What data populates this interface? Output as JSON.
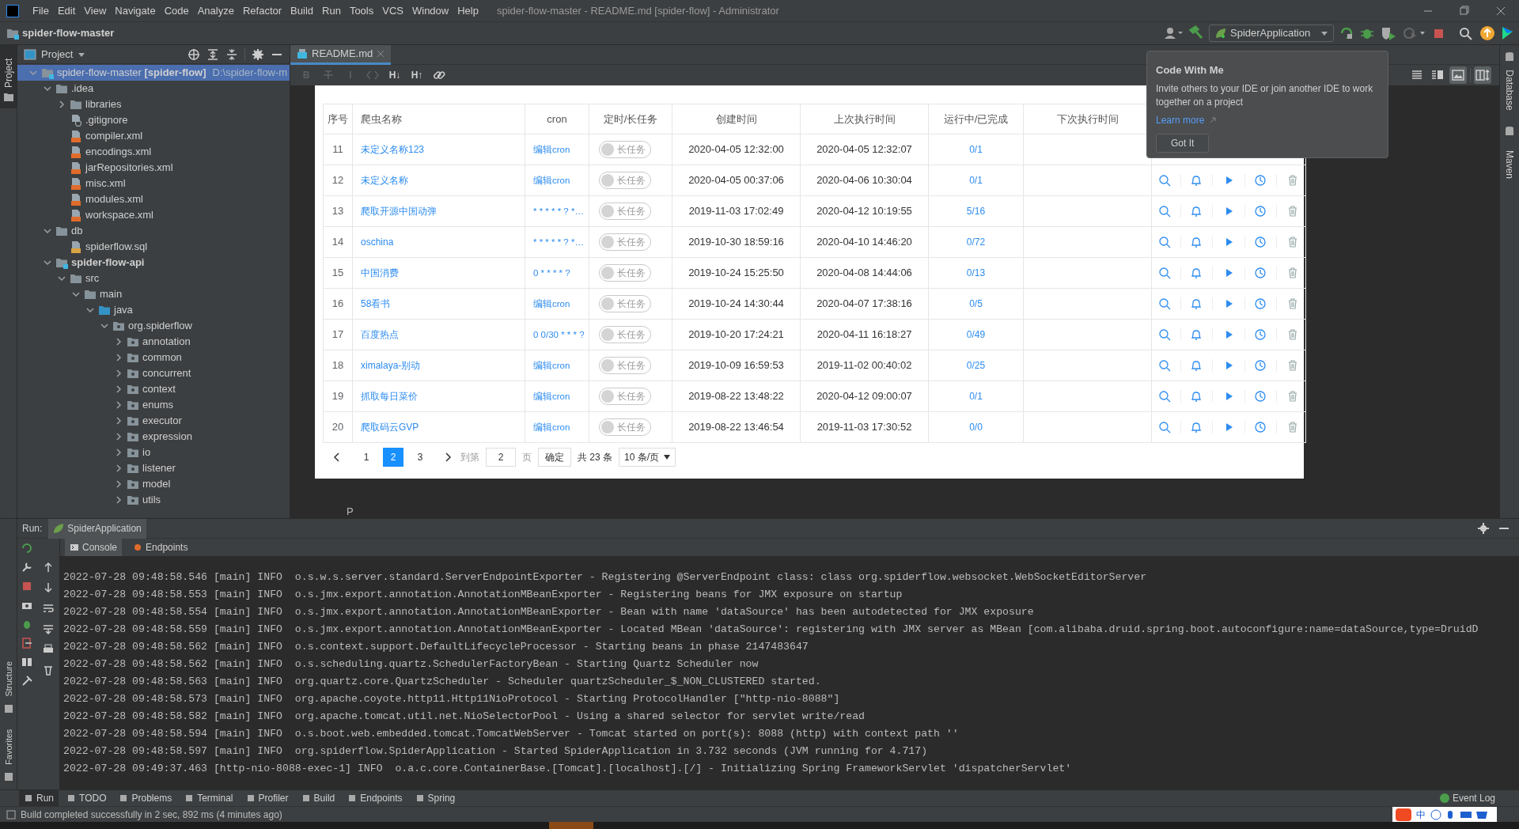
{
  "title_bar": {
    "menu": [
      "File",
      "Edit",
      "View",
      "Navigate",
      "Code",
      "Analyze",
      "Refactor",
      "Build",
      "Run",
      "Tools",
      "VCS",
      "Window",
      "Help"
    ],
    "title": "spider-flow-master - README.md [spider-flow] - Administrator"
  },
  "nav_bar": {
    "breadcrumb": "spider-flow-master",
    "run_config": "SpiderApplication"
  },
  "popup": {
    "title": "Code With Me",
    "text": "Invite others to your IDE or join another IDE to work together on a project",
    "link": "Learn more",
    "button": "Got It"
  },
  "left_stripe": {
    "label": "Project",
    "selected": true
  },
  "project_panel": {
    "title": "Project",
    "tree": [
      {
        "label": "spider-flow-master **[spider-flow]**",
        "path": "D:\\spider-flow-m",
        "kind": "module",
        "bold": false,
        "selected": true,
        "expanded": true,
        "children": [
          {
            "label": ".idea",
            "kind": "folder",
            "bold": false,
            "selected": false,
            "expanded": true,
            "children": [
              {
                "label": "libraries",
                "kind": "folder",
                "bold": false,
                "selected": false,
                "expanded": false
              },
              {
                "label": ".gitignore",
                "kind": "ignore",
                "bold": false,
                "selected": false
              },
              {
                "label": "compiler.xml",
                "kind": "xml",
                "bold": false,
                "selected": false
              },
              {
                "label": "encodings.xml",
                "kind": "xml",
                "bold": false,
                "selected": false
              },
              {
                "label": "jarRepositories.xml",
                "kind": "xml",
                "bold": false,
                "selected": false
              },
              {
                "label": "misc.xml",
                "kind": "xml",
                "bold": false,
                "selected": false
              },
              {
                "label": "modules.xml",
                "kind": "xml",
                "bold": false,
                "selected": false
              },
              {
                "label": "workspace.xml",
                "kind": "xml",
                "bold": false,
                "selected": false
              }
            ]
          },
          {
            "label": "db",
            "kind": "folder",
            "bold": false,
            "selected": false,
            "expanded": true,
            "children": [
              {
                "label": "spiderflow.sql",
                "kind": "sql",
                "bold": false,
                "selected": false
              }
            ]
          },
          {
            "label": "spider-flow-api",
            "kind": "module",
            "bold": true,
            "selected": false,
            "expanded": true,
            "children": [
              {
                "label": "src",
                "kind": "folder",
                "bold": false,
                "selected": false,
                "expanded": true,
                "children": [
                  {
                    "label": "main",
                    "kind": "folder",
                    "bold": false,
                    "selected": false,
                    "expanded": true,
                    "children": [
                      {
                        "label": "java",
                        "kind": "source",
                        "bold": false,
                        "selected": false,
                        "expanded": true,
                        "children": [
                          {
                            "label": "org.spiderflow",
                            "kind": "package",
                            "bold": false,
                            "selected": false,
                            "expanded": true,
                            "children": [
                              {
                                "label": "annotation",
                                "kind": "package",
                                "bold": false,
                                "selected": false,
                                "expanded": false
                              },
                              {
                                "label": "common",
                                "kind": "package",
                                "bold": false,
                                "selected": false,
                                "expanded": false
                              },
                              {
                                "label": "concurrent",
                                "kind": "package",
                                "bold": false,
                                "selected": false,
                                "expanded": false
                              },
                              {
                                "label": "context",
                                "kind": "package",
                                "bold": false,
                                "selected": false,
                                "expanded": false
                              },
                              {
                                "label": "enums",
                                "kind": "package",
                                "bold": false,
                                "selected": false,
                                "expanded": false
                              },
                              {
                                "label": "executor",
                                "kind": "package",
                                "bold": false,
                                "selected": false,
                                "expanded": false
                              },
                              {
                                "label": "expression",
                                "kind": "package",
                                "bold": false,
                                "selected": false,
                                "expanded": false
                              },
                              {
                                "label": "io",
                                "kind": "package",
                                "bold": false,
                                "selected": false,
                                "expanded": false
                              },
                              {
                                "label": "listener",
                                "kind": "package",
                                "bold": false,
                                "selected": false,
                                "expanded": false
                              },
                              {
                                "label": "model",
                                "kind": "package",
                                "bold": false,
                                "selected": false,
                                "expanded": false
                              },
                              {
                                "label": "utils",
                                "kind": "package",
                                "bold": false,
                                "selected": false,
                                "expanded": false
                              }
                            ]
                          }
                        ]
                      }
                    ]
                  }
                ]
              }
            ]
          }
        ]
      }
    ]
  },
  "editor": {
    "tabs": [
      {
        "label": "README.md",
        "selected": true
      }
    ],
    "format_buttons": [
      {
        "kind": "text",
        "label": "B",
        "disabled": true
      },
      {
        "kind": "strike",
        "disabled": true
      },
      {
        "kind": "text",
        "label": "I",
        "disabled": true
      },
      {
        "kind": "code",
        "disabled": true
      },
      {
        "kind": "text",
        "label": "H↓",
        "disabled": false
      },
      {
        "kind": "text",
        "label": "H↑",
        "disabled": false
      },
      {
        "kind": "link",
        "disabled": false
      }
    ],
    "view_modes": [
      {
        "kind": "editor",
        "selected": false
      },
      {
        "kind": "split",
        "selected": false
      },
      {
        "kind": "preview",
        "selected": true
      }
    ],
    "scroll_sync": true,
    "preview": {
      "table": {
        "columns": [
          "序号",
          "爬虫名称",
          "cron",
          "定时/长任务",
          "创建时间",
          "上次执行时间",
          "运行中/已完成",
          "下次执行时间"
        ],
        "rows": [
          {
            "no": "11",
            "name": "未定义名称123",
            "cron": "编辑cron",
            "toggle": {
              "label": "长任务",
              "on": false
            },
            "created": "2020-04-05 12:32:00",
            "last_run": "2020-04-05 12:32:07",
            "progress": "0/1"
          },
          {
            "no": "12",
            "name": "未定义名称",
            "cron": "编辑cron",
            "toggle": {
              "label": "长任务",
              "on": false
            },
            "created": "2020-04-05 00:37:06",
            "last_run": "2020-04-06 10:30:04",
            "progress": "0/1"
          },
          {
            "no": "13",
            "name": "爬取开源中国动弹",
            "cron": "* * * * * ? *…",
            "toggle": {
              "label": "长任务",
              "on": false
            },
            "created": "2019-11-03 17:02:49",
            "last_run": "2020-04-12 10:19:55",
            "progress": "5/16"
          },
          {
            "no": "14",
            "name": "oschina",
            "cron": "* * * * * ? *…",
            "toggle": {
              "label": "长任务",
              "on": false
            },
            "created": "2019-10-30 18:59:16",
            "last_run": "2020-04-10 14:46:20",
            "progress": "0/72"
          },
          {
            "no": "15",
            "name": "中国消费",
            "cron": "0 * * * * ?",
            "toggle": {
              "label": "长任务",
              "on": false
            },
            "created": "2019-10-24 15:25:50",
            "last_run": "2020-04-08 14:44:06",
            "progress": "0/13"
          },
          {
            "no": "16",
            "name": "58看书",
            "cron": "编辑cron",
            "toggle": {
              "label": "长任务",
              "on": false
            },
            "created": "2019-10-24 14:30:44",
            "last_run": "2020-04-07 17:38:16",
            "progress": "0/5"
          },
          {
            "no": "17",
            "name": "百度热点",
            "cron": "0 0/30 * * * ?",
            "toggle": {
              "label": "长任务",
              "on": false
            },
            "created": "2019-10-20 17:24:21",
            "last_run": "2020-04-11 16:18:27",
            "progress": "0/49"
          },
          {
            "no": "18",
            "name": "ximalaya-别动",
            "cron": "编辑cron",
            "toggle": {
              "label": "长任务",
              "on": false
            },
            "created": "2019-10-09 16:59:53",
            "last_run": "2019-11-02 00:40:02",
            "progress": "0/25"
          },
          {
            "no": "19",
            "name": "抓取每日菜价",
            "cron": "编辑cron",
            "toggle": {
              "label": "长任务",
              "on": false
            },
            "created": "2019-08-22 13:48:22",
            "last_run": "2020-04-12 09:00:07",
            "progress": "0/1"
          },
          {
            "no": "20",
            "name": "爬取码云GVP",
            "cron": "编辑cron",
            "toggle": {
              "label": "长任务",
              "on": false
            },
            "created": "2019-08-22 13:46:54",
            "last_run": "2019-11-03 17:30:52",
            "progress": "0/0"
          }
        ]
      },
      "pagination": {
        "pages": [
          {
            "label": "1",
            "selected": false
          },
          {
            "label": "2",
            "selected": true
          },
          {
            "label": "3",
            "selected": false
          }
        ],
        "goto_label": "到第",
        "goto_value": "2",
        "page_unit": "页",
        "confirm": "确定",
        "total": "共 23 条",
        "page_size": "10 条/页"
      },
      "trailing_text": "P"
    }
  },
  "right_stripe": [
    "Database",
    "Maven"
  ],
  "run_panel": {
    "label": "Run:",
    "tab": "SpiderApplication",
    "subtabs": [
      {
        "label": "Console",
        "selected": true
      },
      {
        "label": "Endpoints",
        "selected": false
      }
    ],
    "console_lines": [
      "2022-07-28 09:48:58.546 [main] INFO  o.s.w.s.server.standard.ServerEndpointExporter - Registering @ServerEndpoint class: class org.spiderflow.websocket.WebSocketEditorServer",
      "2022-07-28 09:48:58.553 [main] INFO  o.s.jmx.export.annotation.AnnotationMBeanExporter - Registering beans for JMX exposure on startup",
      "2022-07-28 09:48:58.554 [main] INFO  o.s.jmx.export.annotation.AnnotationMBeanExporter - Bean with name 'dataSource' has been autodetected for JMX exposure",
      "2022-07-28 09:48:58.559 [main] INFO  o.s.jmx.export.annotation.AnnotationMBeanExporter - Located MBean 'dataSource': registering with JMX server as MBean [com.alibaba.druid.spring.boot.autoconfigure:name=dataSource,type=DruidD",
      "2022-07-28 09:48:58.562 [main] INFO  o.s.context.support.DefaultLifecycleProcessor - Starting beans in phase 2147483647",
      "2022-07-28 09:48:58.562 [main] INFO  o.s.scheduling.quartz.SchedulerFactoryBean - Starting Quartz Scheduler now",
      "2022-07-28 09:48:58.563 [main] INFO  org.quartz.core.QuartzScheduler - Scheduler quartzScheduler_$_NON_CLUSTERED started.",
      "2022-07-28 09:48:58.573 [main] INFO  org.apache.coyote.http11.Http11NioProtocol - Starting ProtocolHandler [\"http-nio-8088\"]",
      "2022-07-28 09:48:58.582 [main] INFO  org.apache.tomcat.util.net.NioSelectorPool - Using a shared selector for servlet write/read",
      "2022-07-28 09:48:58.594 [main] INFO  o.s.boot.web.embedded.tomcat.TomcatWebServer - Tomcat started on port(s): 8088 (http) with context path ''",
      "2022-07-28 09:48:58.597 [main] INFO  org.spiderflow.SpiderApplication - Started SpiderApplication in 3.732 seconds (JVM running for 4.717)",
      "2022-07-28 09:49:37.463 [http-nio-8088-exec-1] INFO  o.a.c.core.ContainerBase.[Tomcat].[localhost].[/] - Initializing Spring FrameworkServlet 'dispatcherServlet'"
    ]
  },
  "side_tabs": [
    "Structure",
    "Favorites"
  ],
  "tool_tabs": [
    {
      "label": "Run",
      "selected": true
    },
    {
      "label": "TODO",
      "selected": false
    },
    {
      "label": "Problems",
      "selected": false
    },
    {
      "label": "Terminal",
      "selected": false
    },
    {
      "label": "Profiler",
      "selected": false
    },
    {
      "label": "Build",
      "selected": false
    },
    {
      "label": "Endpoints",
      "selected": false
    },
    {
      "label": "Spring",
      "selected": false
    }
  ],
  "event_log": "Event Log",
  "status_bar": {
    "message": "Build completed successfully in 2 sec, 892 ms (4 minutes ago)",
    "ime": "中"
  }
}
